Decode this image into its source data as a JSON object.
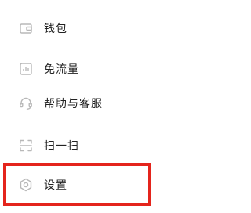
{
  "menu": {
    "items": [
      {
        "label": "钱包",
        "icon": "wallet-icon"
      },
      {
        "label": "免流量",
        "icon": "data-usage-icon"
      },
      {
        "label": "帮助与客服",
        "icon": "headset-icon"
      },
      {
        "label": "扫一扫",
        "icon": "scan-icon"
      },
      {
        "label": "设置",
        "icon": "gear-icon"
      }
    ]
  },
  "colors": {
    "icon": "#b8b8b8",
    "text": "#222222",
    "highlight": "#e4241c",
    "background": "#ffffff"
  }
}
